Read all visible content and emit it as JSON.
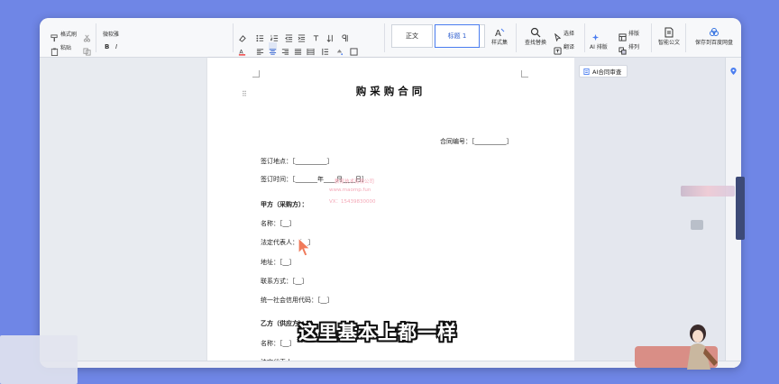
{
  "toolbar": {
    "format_painter": "格式刷",
    "paste": "粘贴",
    "font_name": "微软雅",
    "bold": "B",
    "italic": "I",
    "style_normal": "正文",
    "style_heading1": "标题 1",
    "styles_gallery": "样式集",
    "find_replace": "查找替换",
    "select": "选择",
    "translate": "翻译",
    "ai_layout": "AI 排版",
    "layout": "排版",
    "arrange": "排列",
    "smart_doc": "智能公文",
    "save_to_cloud": "保存到百度网盘"
  },
  "panel": {
    "ai_contract_review": "AI合同审查"
  },
  "document": {
    "title": "购采购合同",
    "contract_no": "合同编号：［__________］",
    "sign_place": "签订地点：［__________］",
    "sign_time": "签订时间：［_______年____月____日］",
    "party_a": "甲方（采购方）：",
    "a_name": "名称：［__］",
    "a_legal_rep": "法定代表人：［__］",
    "a_address": "地址：［__］",
    "a_contact": "联系方式：［__］",
    "a_credit_code": "统一社会信用代码：［__］",
    "party_b": "乙方（供应方）：",
    "b_name": "名称：［__］",
    "b_legal_rep": "法定代表人"
  },
  "overlay": {
    "subtitle": "这里基本上都一样",
    "watermark_line1": "教育技术有限公司",
    "watermark_line2": "www.maomp.fun",
    "watermark_line3": "VX：15439830000"
  },
  "colors": {
    "background": "#6f86e6",
    "accent": "#4a7df0"
  }
}
